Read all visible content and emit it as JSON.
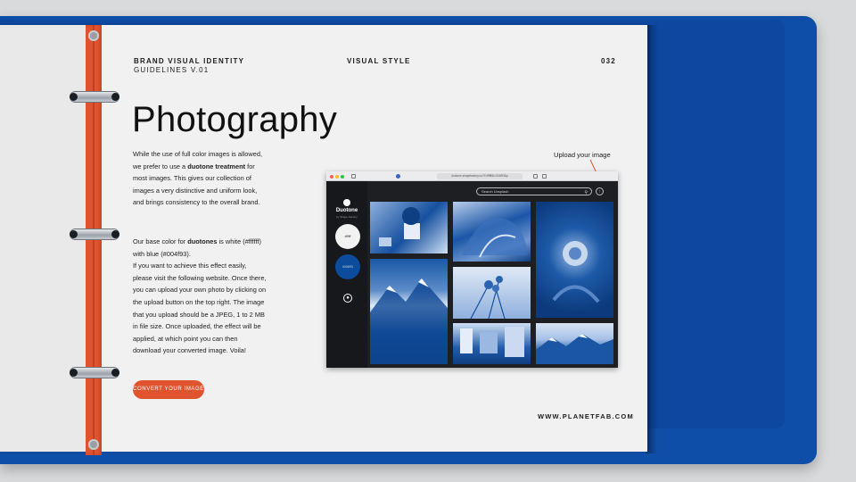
{
  "header": {
    "title": "BRAND VISUAL IDENTITY",
    "subtitle": "GUIDELINES V.01",
    "section": "VISUAL STYLE",
    "page_number": "032"
  },
  "heading": "Photography",
  "intro": {
    "p1_a": "While the use of full color images is allowed, we prefer to use a ",
    "p1_bold1": "duotone treatment",
    "p1_b": " for most images. This gives our collection of images a very distinctive and uniform look, and brings consistency to the overall brand."
  },
  "details": {
    "p2_a": "Our base color for ",
    "p2_bold": "duotones",
    "p2_b": " is white (#ffffff) with blue (#004f93).",
    "p2_c": "If you want to achieve this effect easily, please visit the following website. Once there, you can upload your own photo by clicking on the upload button on the top right. The image that you upload should be a JPEG, 1 to 2 MB in file size. Once uploaded, the effect will be applied, at which point you can then download your converted image. Voila!"
  },
  "cta_label": "CONVERT YOUR IMAGE",
  "footer_url": "WWW.PLANETFAB.COM",
  "annotation": "Upload your image",
  "screenshot": {
    "url": "duotone.shapefactory.co/?f=ffffff&t=004f93&p",
    "app_name": "Duotone",
    "app_byline": "by Shape Factory",
    "swatch_light": "#ffffff",
    "swatch_dark": "#004f93",
    "search_placeholder": "Search Unsplash"
  },
  "colors": {
    "accent": "#e0532f",
    "binder_blue": "#0f4ea8",
    "duotone_blue": "#004f93",
    "page": "#f1f1f2"
  },
  "icons": [
    "ring-binder-icon",
    "arrow-icon",
    "search-icon",
    "upload-icon",
    "drop-icon",
    "app-logo-icon"
  ]
}
